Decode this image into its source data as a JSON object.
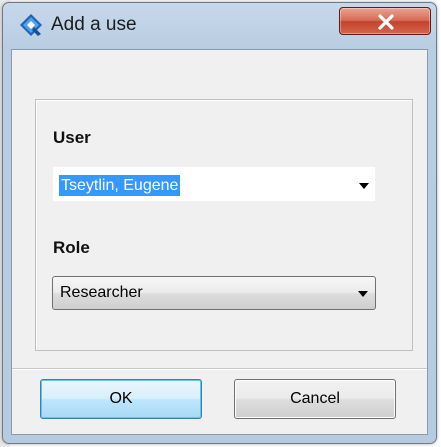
{
  "window": {
    "title": "Add a use",
    "close_symbol": "X",
    "icon": "app-logo-icon"
  },
  "form": {
    "user": {
      "label": "User",
      "value": "Tseytlin, Eugene",
      "selected": true
    },
    "role": {
      "label": "Role",
      "value": "Researcher"
    }
  },
  "buttons": {
    "ok_label": "OK",
    "cancel_label": "Cancel"
  },
  "colors": {
    "selection_highlight": "#3399ff",
    "close_button": "#c3432b",
    "title_bar": "#b9cde2",
    "dialog_body": "#f0f0f0",
    "default_button_border": "#3c7fb1"
  }
}
